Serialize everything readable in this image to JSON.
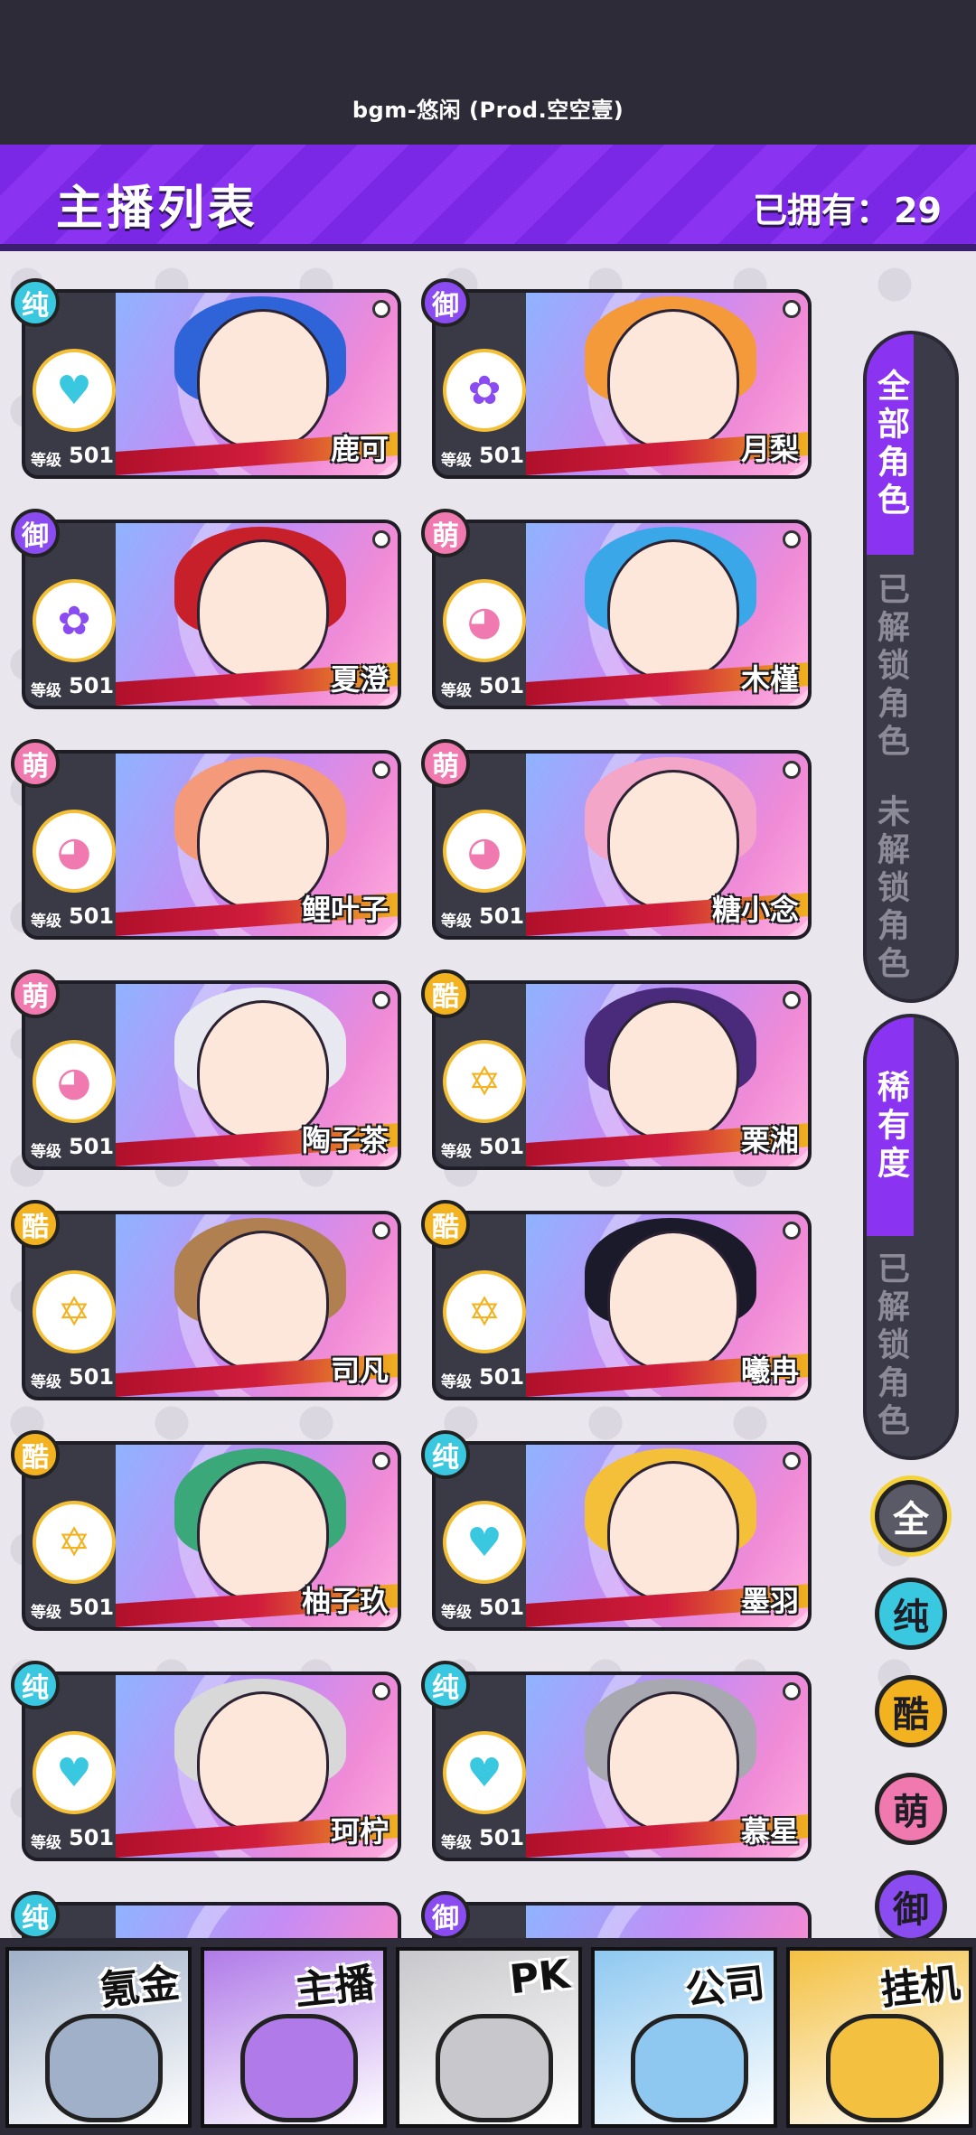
{
  "top": {
    "bgm": "bgm-悠闲 (Prod.空空壹)"
  },
  "header": {
    "title": "主播列表",
    "owned_label": "已拥有：",
    "owned_count": "29"
  },
  "card_level_label": "等级",
  "cards": [
    {
      "name": "鹿可",
      "level": "501",
      "badge": "纯",
      "badge_color": "#3ac8e0",
      "emblem": "heart-pulse-icon",
      "hair": "#2e64d8"
    },
    {
      "name": "月梨",
      "level": "501",
      "badge": "御",
      "badge_color": "#8a4bf0",
      "emblem": "rose-icon",
      "hair": "#f49a3a"
    },
    {
      "name": "夏澄",
      "level": "501",
      "badge": "御",
      "badge_color": "#8a4bf0",
      "emblem": "rose-icon",
      "hair": "#c8202a"
    },
    {
      "name": "木槿",
      "level": "501",
      "badge": "萌",
      "badge_color": "#f07ab0",
      "emblem": "cat-icon",
      "hair": "#3aa8e8"
    },
    {
      "name": "鲤叶子",
      "level": "501",
      "badge": "萌",
      "badge_color": "#f07ab0",
      "emblem": "cat-icon",
      "hair": "#f49a7a"
    },
    {
      "name": "糖小念",
      "level": "501",
      "badge": "萌",
      "badge_color": "#f07ab0",
      "emblem": "cat-icon",
      "hair": "#f4a6c8"
    },
    {
      "name": "陶子茶",
      "level": "501",
      "badge": "萌",
      "badge_color": "#f07ab0",
      "emblem": "cat-icon",
      "hair": "#e8e8f0"
    },
    {
      "name": "栗湘",
      "level": "501",
      "badge": "酷",
      "badge_color": "#f3b21f",
      "emblem": "star-icon",
      "hair": "#4a2a7a"
    },
    {
      "name": "司凡",
      "level": "501",
      "badge": "酷",
      "badge_color": "#f3b21f",
      "emblem": "star-icon",
      "hair": "#b08050"
    },
    {
      "name": "曦冉",
      "level": "501",
      "badge": "酷",
      "badge_color": "#f3b21f",
      "emblem": "star-icon",
      "hair": "#1a1a2a"
    },
    {
      "name": "柚子玖",
      "level": "501",
      "badge": "酷",
      "badge_color": "#f3b21f",
      "emblem": "star-icon",
      "hair": "#3aa878"
    },
    {
      "name": "墨羽",
      "level": "501",
      "badge": "纯",
      "badge_color": "#3ac8e0",
      "emblem": "heart-pulse-icon",
      "hair": "#f4c03a"
    },
    {
      "name": "珂柠",
      "level": "501",
      "badge": "纯",
      "badge_color": "#3ac8e0",
      "emblem": "heart-pulse-icon",
      "hair": "#d8d8d8"
    },
    {
      "name": "慕星",
      "level": "501",
      "badge": "纯",
      "badge_color": "#3ac8e0",
      "emblem": "heart-pulse-icon",
      "hair": "#a8a8b0"
    }
  ],
  "partial_badges": [
    "纯",
    "御"
  ],
  "side": {
    "group1": [
      "全部角色",
      "已解锁角色",
      "未解锁角色"
    ],
    "group2": [
      "稀有度",
      "已解锁角色"
    ]
  },
  "filters": [
    {
      "label": "全",
      "color": "#5a5966",
      "text_color": "#ffffff"
    },
    {
      "label": "纯",
      "color": "#3ac8e0",
      "text_color": "#1e1d26"
    },
    {
      "label": "酷",
      "color": "#f3b21f",
      "text_color": "#1e1d26"
    },
    {
      "label": "萌",
      "color": "#f07ab0",
      "text_color": "#1e1d26"
    },
    {
      "label": "御",
      "color": "#8a4bf0",
      "text_color": "#1e1d26"
    }
  ],
  "nav": [
    {
      "label": "氪金",
      "color": "#9fb0c8"
    },
    {
      "label": "主播",
      "color": "#b07ae8"
    },
    {
      "label": "PK",
      "color": "#c8c8cc"
    },
    {
      "label": "公司",
      "color": "#8ec8f0"
    },
    {
      "label": "挂机",
      "color": "#f3c040"
    }
  ]
}
